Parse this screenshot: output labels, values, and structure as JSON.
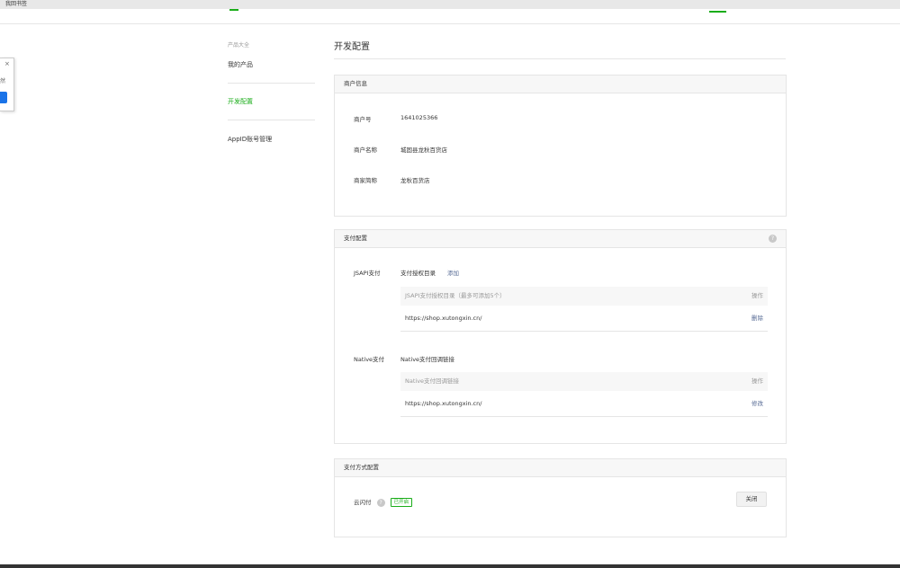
{
  "browser": {
    "bookmark": "我回书签"
  },
  "popup": {
    "close": "×",
    "text": "然"
  },
  "sidebar": {
    "group_title": "产品大全",
    "items": [
      {
        "label": "我的产品"
      },
      {
        "label": "开发配置"
      },
      {
        "label": "AppID账号管理"
      }
    ]
  },
  "main": {
    "title": "开发配置",
    "merchant": {
      "header": "商户信息",
      "rows": [
        {
          "label": "商户号",
          "value": "1641025366"
        },
        {
          "label": "商户名称",
          "value": "城固县龙秋百货店"
        },
        {
          "label": "商家简称",
          "value": "龙秋百货店"
        }
      ]
    },
    "payment": {
      "header": "支付配置",
      "help": "?",
      "jsapi": {
        "label": "JSAPI支付",
        "sub_label": "支付授权目录",
        "add_link": "添加",
        "table_header": "JSAPI支付授权目录（最多可添加5个）",
        "op_header": "操作",
        "rows": [
          {
            "url": "https://shop.xutongxin.cn/",
            "action": "删除"
          }
        ]
      },
      "native": {
        "label": "Native支付",
        "sub_label": "Native支付回调链接",
        "table_header": "Native支付回调链接",
        "op_header": "操作",
        "rows": [
          {
            "url": "https://shop.xutongxin.cn/",
            "action": "修改"
          }
        ]
      }
    },
    "methods": {
      "header": "支付方式配置",
      "item": {
        "label": "云闪付",
        "help": "?",
        "status": "已开启",
        "button": "关闭"
      }
    }
  },
  "colors": {
    "accent": "#1aad19",
    "link": "#576b95"
  }
}
